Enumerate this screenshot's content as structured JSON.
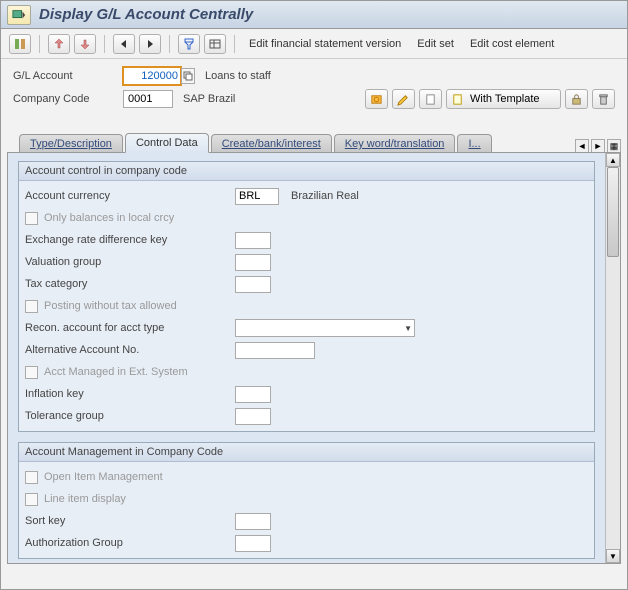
{
  "title": "Display G/L Account Centrally",
  "toolbar": {
    "link1": "Edit financial statement version",
    "link2": "Edit set",
    "link3": "Edit cost element"
  },
  "header": {
    "gl_label": "G/L Account",
    "gl_value": "120000",
    "gl_desc": "Loans to staff",
    "cc_label": "Company Code",
    "cc_value": "0001",
    "cc_desc": "SAP Brazil",
    "with_template": "With Template"
  },
  "tabs": {
    "t1": "Type/Description",
    "t2": "Control Data",
    "t3": "Create/bank/interest",
    "t4": "Key word/translation",
    "t5": "I..."
  },
  "group1": {
    "title": "Account control in company code",
    "currency_label": "Account currency",
    "currency_value": "BRL",
    "currency_desc": "Brazilian Real",
    "only_balances": "Only balances in local crcy",
    "erate": "Exchange rate difference key",
    "valgroup": "Valuation group",
    "taxcat": "Tax category",
    "posting_wo_tax": "Posting without tax allowed",
    "recon": "Recon. account for acct type",
    "altacct": "Alternative Account No.",
    "acct_ext": "Acct Managed in Ext. System",
    "inflation": "Inflation key",
    "tolerance": "Tolerance group"
  },
  "group2": {
    "title": "Account Management in Company Code",
    "open_item": "Open Item Management",
    "line_item": "Line item display",
    "sortkey": "Sort key",
    "authgroup": "Authorization Group"
  }
}
